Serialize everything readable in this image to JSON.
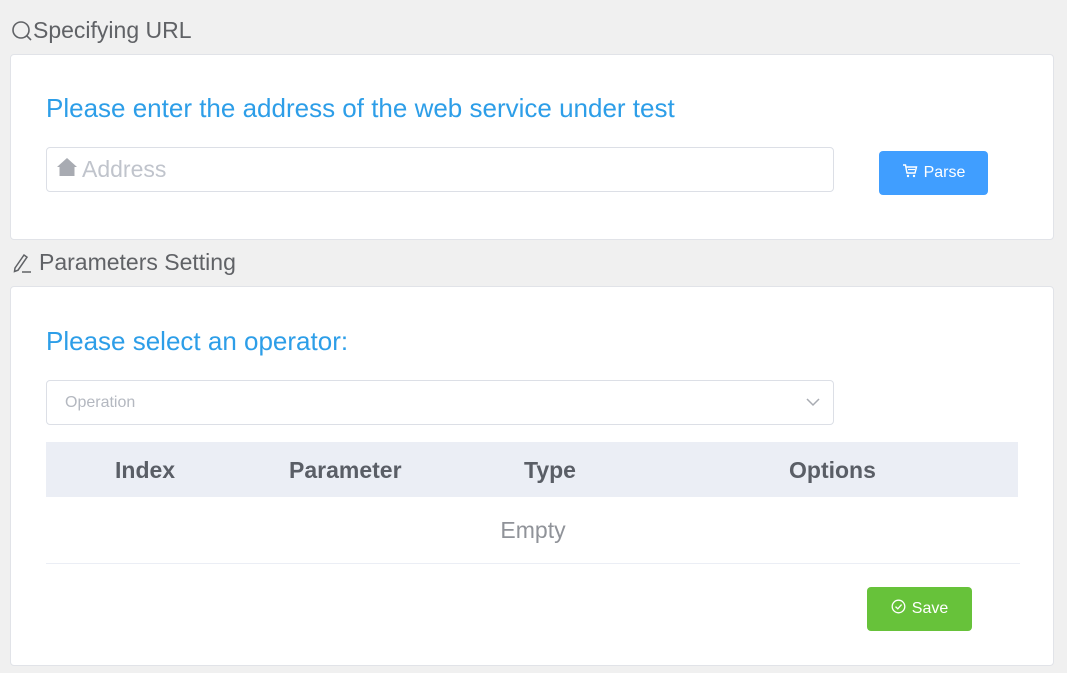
{
  "url_section": {
    "title": "Specifying URL",
    "prompt": "Please enter the address of the web service under test",
    "address_placeholder": "Address",
    "address_value": "",
    "parse_label": "Parse"
  },
  "params_section": {
    "title": "Parameters Setting",
    "prompt": "Please select an operator:",
    "operation_placeholder": "Operation",
    "table": {
      "columns": [
        "Index",
        "Parameter",
        "Type",
        "Options"
      ],
      "rows": [],
      "empty_text": "Empty"
    },
    "save_label": "Save"
  },
  "colors": {
    "accent_text": "#2d9ee8",
    "primary_button": "#409eff",
    "success_button": "#67c23a",
    "page_background": "#f0f0f0"
  },
  "icons": {
    "url_title": "search-icon",
    "params_title": "edit-pencil-icon",
    "address": "home-icon",
    "parse": "cart-icon",
    "select": "chevron-down-icon",
    "save": "check-circle-icon"
  }
}
